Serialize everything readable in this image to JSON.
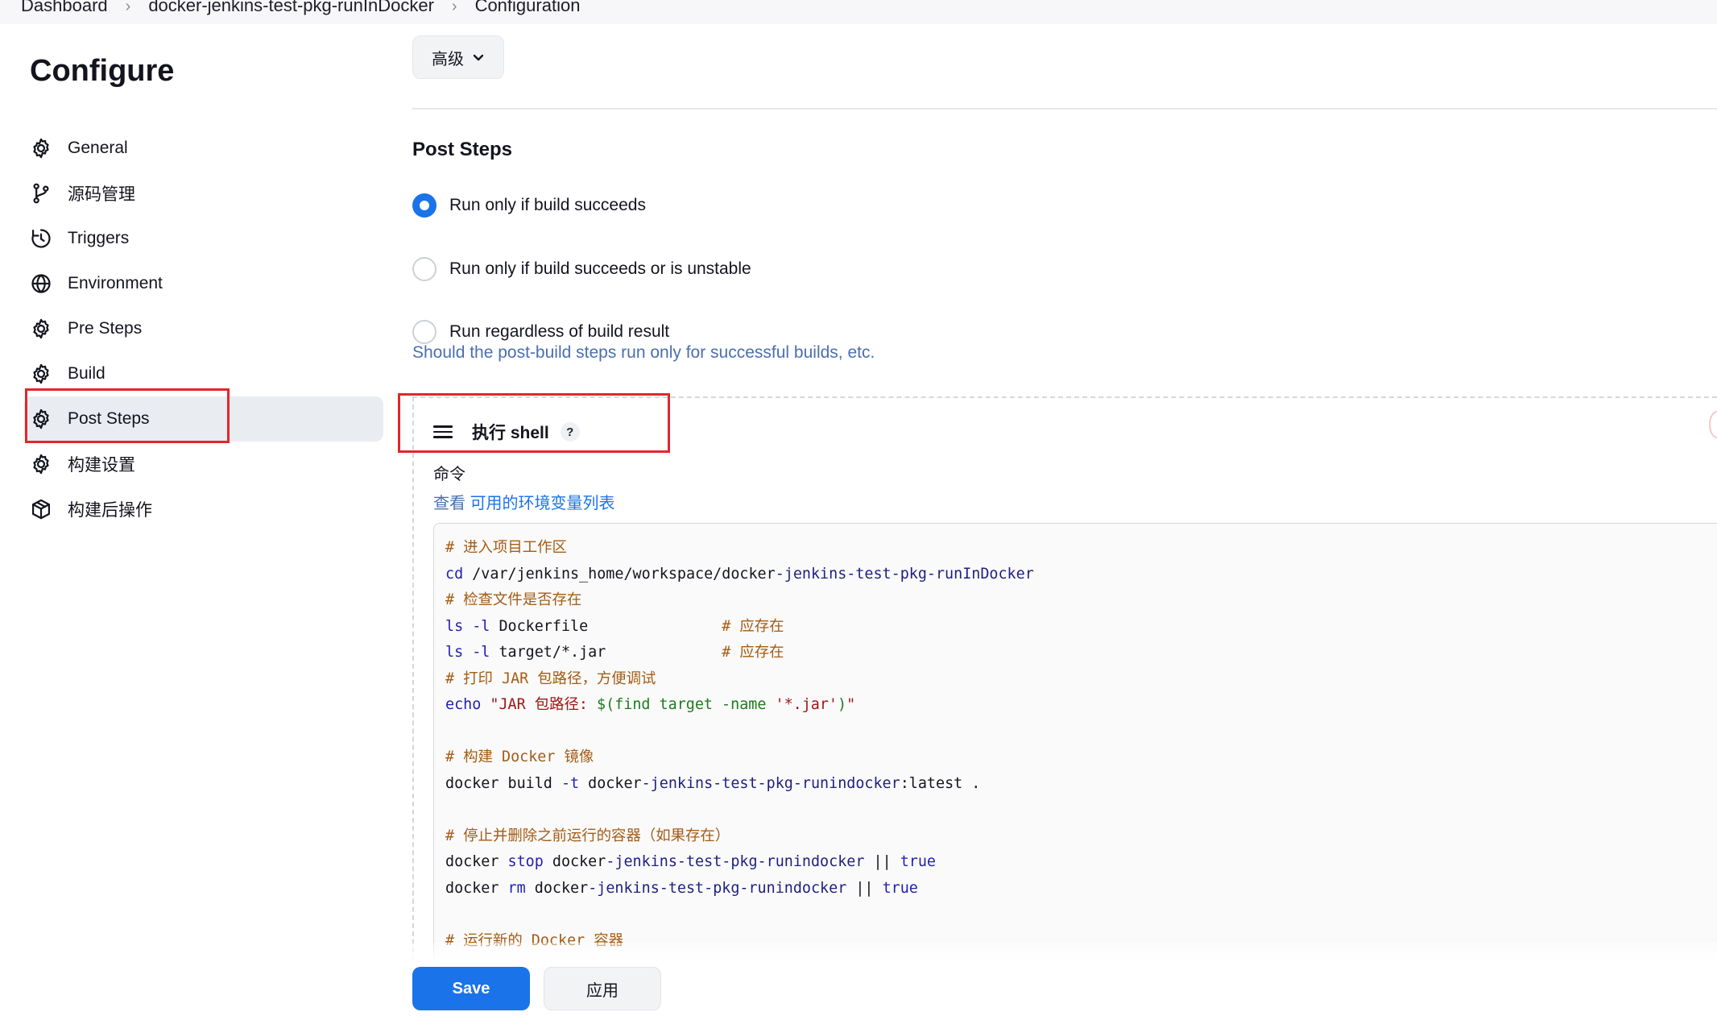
{
  "breadcrumb": {
    "items": [
      "Dashboard",
      "docker-jenkins-test-pkg-runInDocker",
      "Configuration"
    ]
  },
  "sidebar": {
    "title": "Configure",
    "items": [
      {
        "label": "General",
        "icon": "gear-icon"
      },
      {
        "label": "源码管理",
        "icon": "branch-icon"
      },
      {
        "label": "Triggers",
        "icon": "clock-icon"
      },
      {
        "label": "Environment",
        "icon": "globe-icon"
      },
      {
        "label": "Pre Steps",
        "icon": "gear-icon"
      },
      {
        "label": "Build",
        "icon": "gear-icon"
      },
      {
        "label": "Post Steps",
        "icon": "gear-icon",
        "active": true
      },
      {
        "label": "构建设置",
        "icon": "gear-icon"
      },
      {
        "label": "构建后操作",
        "icon": "cube-icon"
      }
    ]
  },
  "toolbar": {
    "advanced_label": "高级"
  },
  "post_steps": {
    "title": "Post Steps",
    "options": [
      {
        "label": "Run only if build succeeds",
        "checked": true
      },
      {
        "label": "Run only if build succeeds or is unstable",
        "checked": false
      },
      {
        "label": "Run regardless of build result",
        "checked": false
      }
    ],
    "help": "Should the post-build steps run only for successful builds, etc."
  },
  "shell_step": {
    "title": "执行 shell",
    "help_label": "?",
    "command_label": "命令",
    "env_prefix": "查看 ",
    "env_link": "可用的环境变量列表"
  },
  "code": {
    "l1": "# 进入项目工作区",
    "l2a": "cd",
    "l2b": " /var/jenkins_home/workspace/docker",
    "l2c": "-jenkins-test-pkg-runInDocker",
    "l3": "# 检查文件是否存在",
    "l4a": "ls",
    "l4b": " -l",
    "l4c": " Dockerfile               ",
    "l4d": "# 应存在",
    "l5a": "ls",
    "l5b": " -l",
    "l5c": " target/*.jar             ",
    "l5d": "# 应存在",
    "l6": "# 打印 JAR 包路径，方便调试",
    "l7a": "echo",
    "l7b": " \"JAR 包路径: ",
    "l7c": "$(find target -name ",
    "l7d": "'*.jar'",
    "l7e": ")",
    "l7f": "\"",
    "l9": "# 构建 Docker 镜像",
    "l10a": "docker build ",
    "l10b": "-t",
    "l10c": " docker",
    "l10d": "-jenkins-test-pkg-runindocker",
    "l10e": ":latest .",
    "l12": "# 停止并删除之前运行的容器（如果存在）",
    "l13a": "docker ",
    "l13b": "stop",
    "l13c": " docker",
    "l13d": "-jenkins-test-pkg-runindocker",
    "l13e": " || ",
    "l13f": "true",
    "l14a": "docker ",
    "l14b": "rm",
    "l14c": " docker",
    "l14d": "-jenkins-test-pkg-runindocker",
    "l14e": " || ",
    "l14f": "true",
    "l16": "# 运行新的 Docker 容器"
  },
  "actions": {
    "save_label": "Save",
    "apply_label": "应用"
  },
  "colors": {
    "accent": "#1a73e8",
    "highlight_box": "#e3262c",
    "help_text": "#4a6fb0"
  }
}
